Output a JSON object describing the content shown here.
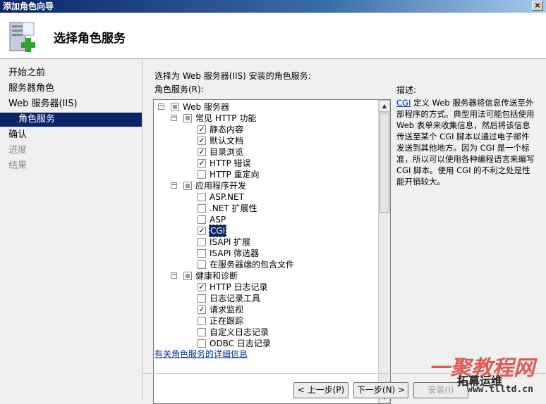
{
  "window": {
    "title": "添加角色向导",
    "close_glyph": "×"
  },
  "header": {
    "title": "选择角色服务",
    "icon": "server-add-icon"
  },
  "nav": {
    "items": [
      {
        "label": "开始之前",
        "state": "normal"
      },
      {
        "label": "服务器角色",
        "state": "normal"
      },
      {
        "label": "Web 服务器(IIS)",
        "state": "normal"
      },
      {
        "label": "角色服务",
        "state": "selected"
      },
      {
        "label": "确认",
        "state": "normal"
      },
      {
        "label": "进度",
        "state": "disabled"
      },
      {
        "label": "结果",
        "state": "disabled"
      }
    ]
  },
  "main": {
    "prompt": "选择为 Web 服务器(IIS) 安装的角色服务:",
    "tree_label": "角色服务(R):",
    "tree": [
      {
        "label": "Web 服务器",
        "level": 0,
        "expander": "−",
        "check": "partial"
      },
      {
        "label": "常见 HTTP 功能",
        "level": 1,
        "expander": "−",
        "check": "partial"
      },
      {
        "label": "静态内容",
        "level": 2,
        "check": "checked"
      },
      {
        "label": "默认文档",
        "level": 2,
        "check": "checked"
      },
      {
        "label": "目录浏览",
        "level": 2,
        "check": "checked"
      },
      {
        "label": "HTTP 错误",
        "level": 2,
        "check": "checked"
      },
      {
        "label": "HTTP 重定向",
        "level": 2,
        "check": "unchecked"
      },
      {
        "label": "应用程序开发",
        "level": 1,
        "expander": "−",
        "check": "partial"
      },
      {
        "label": "ASP.NET",
        "level": 2,
        "check": "unchecked"
      },
      {
        "label": ".NET 扩展性",
        "level": 2,
        "check": "unchecked"
      },
      {
        "label": "ASP",
        "level": 2,
        "check": "unchecked"
      },
      {
        "label": "CGI",
        "level": 2,
        "check": "checked",
        "selected": true
      },
      {
        "label": "ISAPI 扩展",
        "level": 2,
        "check": "unchecked"
      },
      {
        "label": "ISAPI 筛选器",
        "level": 2,
        "check": "unchecked"
      },
      {
        "label": "在服务器端的包含文件",
        "level": 2,
        "check": "unchecked"
      },
      {
        "label": "健康和诊断",
        "level": 1,
        "expander": "−",
        "check": "partial"
      },
      {
        "label": "HTTP 日志记录",
        "level": 2,
        "check": "checked"
      },
      {
        "label": "日志记录工具",
        "level": 2,
        "check": "unchecked"
      },
      {
        "label": "请求监视",
        "level": 2,
        "check": "checked"
      },
      {
        "label": "正在跟踪",
        "level": 2,
        "check": "unchecked"
      },
      {
        "label": "自定义日志记录",
        "level": 2,
        "check": "unchecked"
      },
      {
        "label": "ODBC 日志记录",
        "level": 2,
        "check": "unchecked"
      }
    ],
    "description_title": "描述:",
    "description_link": "CGI",
    "description_text": " 定义 Web 服务器将信息传送至外部程序的方式。典型用法可能包括使用 Web 表单来收集信息，然后将该信息传送至某个 CGI 脚本以通过电子邮件发送到其他地方。因为 CGI 是一个标准，所以可以使用各种编程语言来编写 CGI 脚本。使用 CGI 的不利之处是性能开销较大。",
    "more_info_link": "有关角色服务的详细信息"
  },
  "footer": {
    "back_label": "< 上一步(P)",
    "next_label": "下一步(N) >",
    "install_label": "安装(I)"
  },
  "watermark": {
    "site_cn": "一聚教程网",
    "brand": "拓幕运维",
    "url": "www.tlltd.cn"
  }
}
